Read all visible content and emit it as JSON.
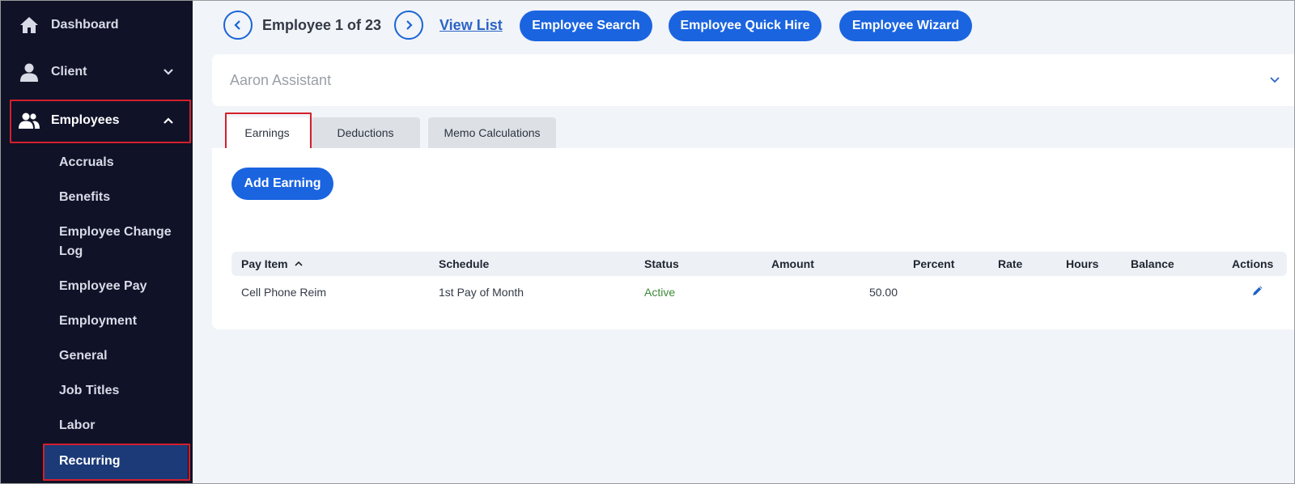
{
  "sidebar": {
    "top_items": [
      {
        "label": "Dashboard",
        "icon": "home-icon"
      },
      {
        "label": "Client",
        "icon": "user-icon"
      },
      {
        "label": "Employees",
        "icon": "users-icon"
      }
    ],
    "sub_items": [
      "Accruals",
      "Benefits",
      "Employee Change Log",
      "Employee Pay",
      "Employment",
      "General",
      "Job Titles",
      "Labor",
      "Recurring"
    ],
    "active_item": "Recurring"
  },
  "toolbar": {
    "employee_count": "Employee 1 of 23",
    "view_list": "View List",
    "buttons": [
      "Employee Search",
      "Employee Quick Hire",
      "Employee Wizard"
    ]
  },
  "employee": {
    "name": "Aaron Assistant"
  },
  "tabs": [
    {
      "label": "Earnings",
      "active": true
    },
    {
      "label": "Deductions",
      "active": false
    },
    {
      "label": "Memo Calculations",
      "active": false
    }
  ],
  "earnings": {
    "add_label": "Add Earning",
    "columns": [
      "Pay Item",
      "Schedule",
      "Status",
      "Amount",
      "Percent",
      "Rate",
      "Hours",
      "Balance",
      "Actions"
    ],
    "rows": [
      {
        "pay_item": "Cell Phone Reim",
        "schedule": "1st Pay of Month",
        "status": "Active",
        "amount": "50.00",
        "percent": "",
        "rate": "",
        "hours": "",
        "balance": ""
      }
    ]
  },
  "colors": {
    "sidebar_bg": "#101228",
    "primary": "#1a64e0",
    "highlight": "#d4202c",
    "status_active": "#3f8a3a"
  }
}
